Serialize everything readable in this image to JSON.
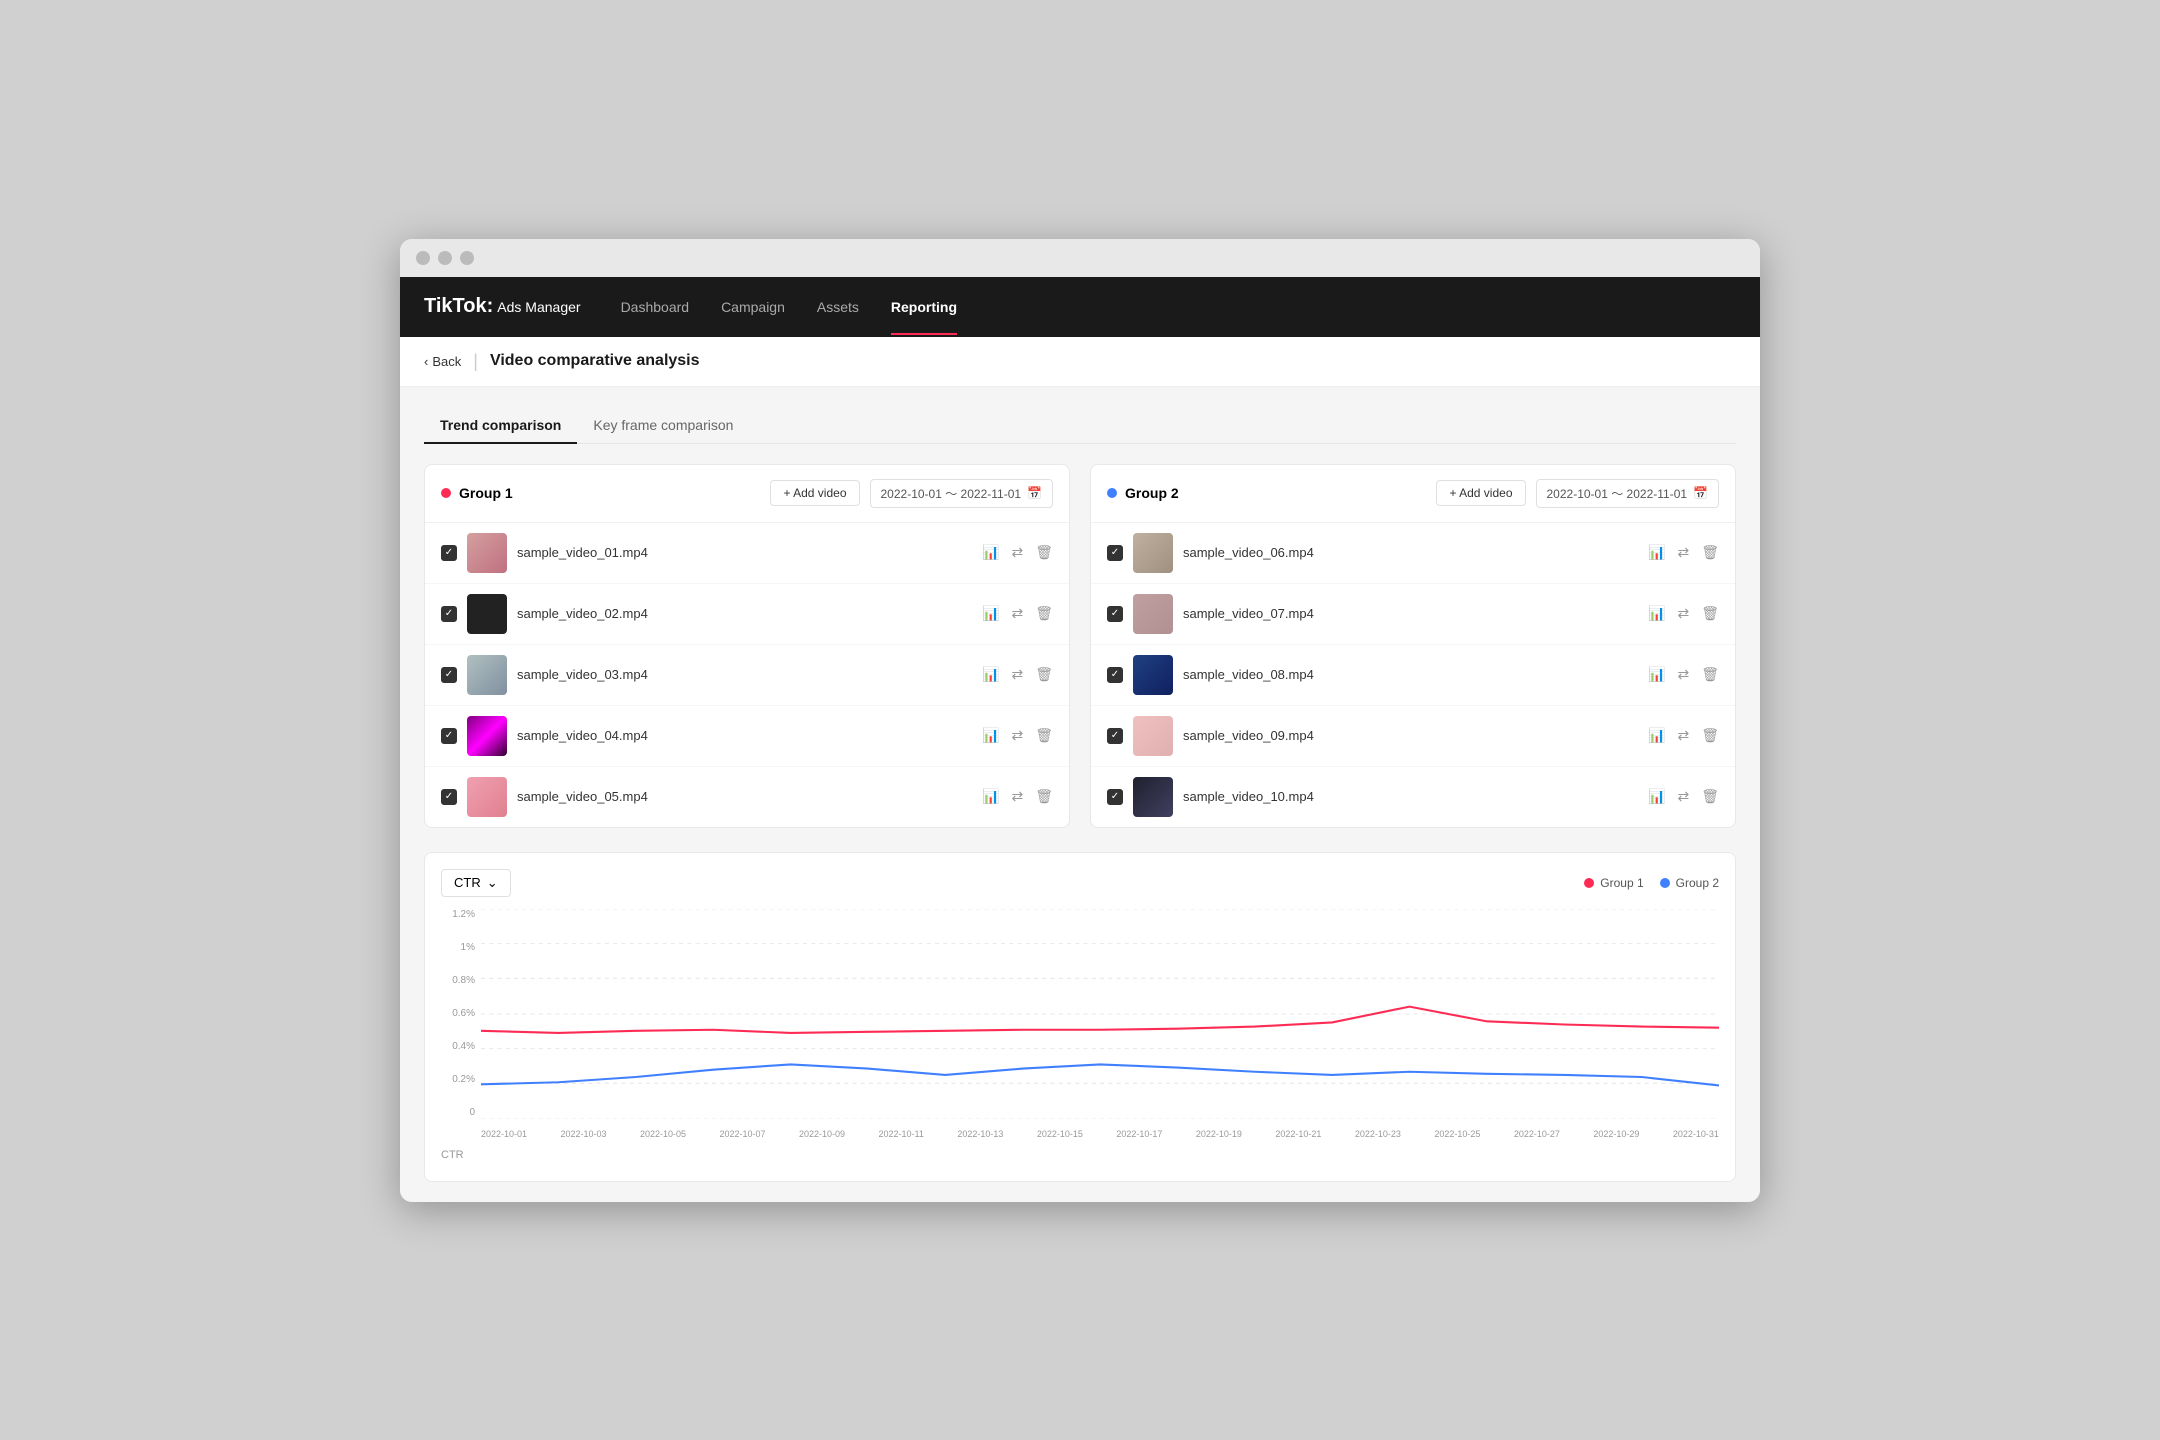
{
  "window": {
    "title": "TikTok Ads Manager"
  },
  "nav": {
    "logo": "TikTok:",
    "logo_sub": "Ads Manager",
    "items": [
      {
        "label": "Dashboard",
        "active": false
      },
      {
        "label": "Campaign",
        "active": false
      },
      {
        "label": "Assets",
        "active": false
      },
      {
        "label": "Reporting",
        "active": true
      }
    ]
  },
  "breadcrumb": {
    "back": "Back",
    "title": "Video comparative analysis"
  },
  "tabs": [
    {
      "label": "Trend comparison",
      "active": true
    },
    {
      "label": "Key frame comparison",
      "active": false
    }
  ],
  "group1": {
    "label": "Group 1",
    "dot_color": "#fe2c55",
    "add_video": "+ Add video",
    "date_range": "2022-10-01 ～ 2022-11-01",
    "videos": [
      {
        "name": "sample_video_01.mp4",
        "thumb": "1"
      },
      {
        "name": "sample_video_02.mp4",
        "thumb": "2"
      },
      {
        "name": "sample_video_03.mp4",
        "thumb": "3"
      },
      {
        "name": "sample_video_04.mp4",
        "thumb": "4"
      },
      {
        "name": "sample_video_05.mp4",
        "thumb": "5"
      }
    ]
  },
  "group2": {
    "label": "Group 2",
    "dot_color": "#4080ff",
    "add_video": "+ Add video",
    "date_range": "2022-10-01 ～ 2022-11-01",
    "videos": [
      {
        "name": "sample_video_06.mp4",
        "thumb": "6"
      },
      {
        "name": "sample_video_07.mp4",
        "thumb": "7"
      },
      {
        "name": "sample_video_08.mp4",
        "thumb": "8"
      },
      {
        "name": "sample_video_09.mp4",
        "thumb": "9"
      },
      {
        "name": "sample_video_10.mp4",
        "thumb": "10"
      }
    ]
  },
  "chart": {
    "metric": "CTR",
    "y_labels": [
      "1.2%",
      "1%",
      "0.8%",
      "0.6%",
      "0.4%",
      "0.2%",
      "0"
    ],
    "x_labels": [
      "2022-10-01",
      "2022-10-03",
      "2022-10-05",
      "2022-10-07",
      "2022-10-09",
      "2022-10-11",
      "2022-10-13",
      "2022-10-15",
      "2022-10-17",
      "2022-10-19",
      "2022-10-21",
      "2022-10-23",
      "2022-10-25",
      "2022-10-27",
      "2022-10-29",
      "2022-10-31"
    ],
    "legend": [
      {
        "label": "Group 1",
        "color": "#fe2c55"
      },
      {
        "label": "Group 2",
        "color": "#4080ff"
      }
    ]
  }
}
